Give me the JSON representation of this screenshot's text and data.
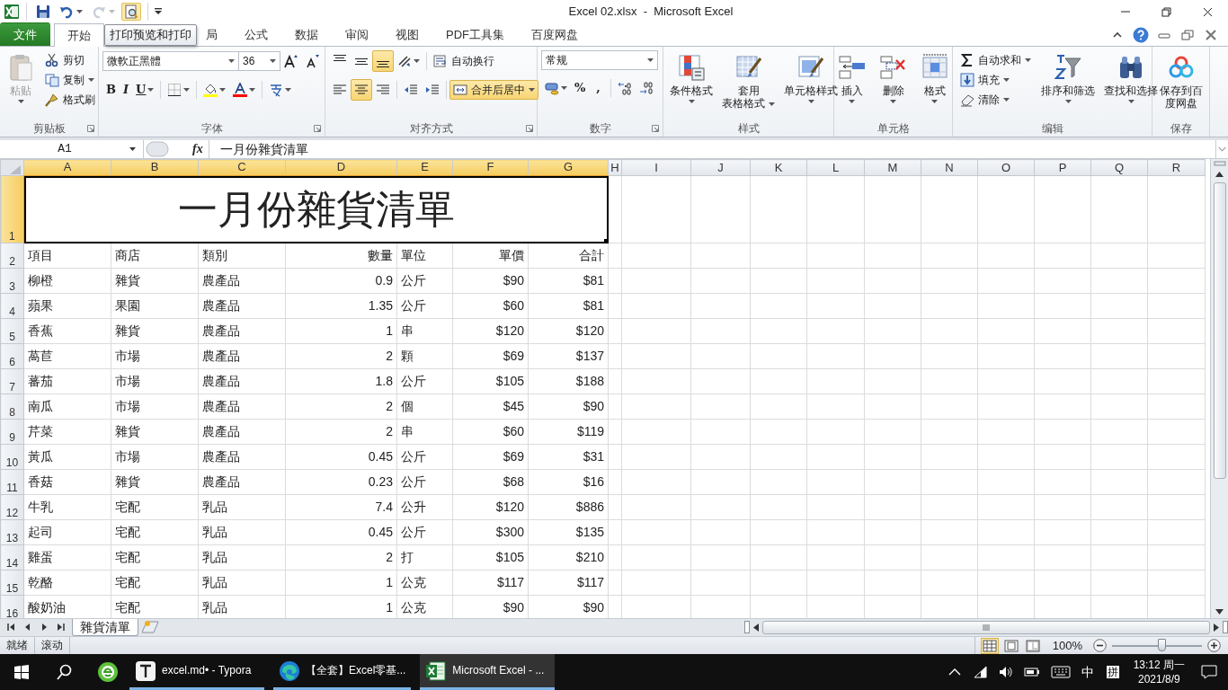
{
  "window": {
    "title": "Excel 02.xlsx  -  Microsoft Excel"
  },
  "quick_access": [
    {
      "disabled": false,
      "hovered": false
    },
    {
      "disabled": false,
      "hovered": false
    },
    {
      "disabled": true,
      "hovered": false
    },
    {
      "disabled": false,
      "hovered": true
    }
  ],
  "tooltip": {
    "text": "打印预览和打印"
  },
  "tabs": [
    {
      "label": "文件",
      "kind": "file",
      "selected": false
    },
    {
      "label": "开始",
      "kind": "tab",
      "selected": true
    },
    {
      "label": "局",
      "kind": "partial",
      "selected": false
    },
    {
      "label": "公式",
      "kind": "tab",
      "selected": false
    },
    {
      "label": "数据",
      "kind": "tab",
      "selected": false
    },
    {
      "label": "审阅",
      "kind": "tab",
      "selected": false
    },
    {
      "label": "视图",
      "kind": "tab",
      "selected": false
    },
    {
      "label": "PDF工具集",
      "kind": "tab",
      "selected": false
    },
    {
      "label": "百度网盘",
      "kind": "tab",
      "selected": false
    }
  ],
  "ribbon": {
    "clipboard": {
      "label": "剪贴板",
      "paste": {
        "label": "粘贴",
        "disabled": true
      },
      "cut": "剪切",
      "copy": "复制",
      "format_painter": "格式刷"
    },
    "font": {
      "label": "字体",
      "font_name": "微軟正黑體",
      "font_size": "36",
      "bold": "B",
      "italic": "I",
      "underline": "U"
    },
    "alignment": {
      "label": "对齐方式",
      "vertical": [
        {
          "selected": false
        },
        {
          "selected": false
        },
        {
          "selected": true
        }
      ],
      "horizontal": [
        {
          "selected": false
        },
        {
          "selected": true
        },
        {
          "selected": false
        }
      ],
      "wrap_text": "自动换行",
      "merge_center": {
        "label": "合并后居中",
        "selected": true
      }
    },
    "number": {
      "label": "数字",
      "format": "常规",
      "percent": "%",
      "comma": ","
    },
    "styles": {
      "label": "样式",
      "conditional": "条件格式",
      "table_format": [
        "套用",
        "表格格式"
      ],
      "cell_styles": "单元格样式"
    },
    "cells": {
      "label": "单元格",
      "buttons": [
        "插入",
        "删除",
        "格式"
      ]
    },
    "editing": {
      "label": "编辑",
      "autosum": "自动求和",
      "fill": "填充",
      "clear": "清除",
      "sort_filter": "排序和筛选",
      "find_select": "查找和选择"
    },
    "save": {
      "label": "保存",
      "button": [
        "保存到百",
        "度网盘"
      ]
    }
  },
  "formula_bar": {
    "name_box": "A1",
    "fx": "fx",
    "formula": "一月份雜貨清單"
  },
  "sheet": {
    "columns": [
      {
        "label": "A",
        "selected": true
      },
      {
        "label": "B",
        "selected": true
      },
      {
        "label": "C",
        "selected": true
      },
      {
        "label": "D",
        "selected": true
      },
      {
        "label": "E",
        "selected": true
      },
      {
        "label": "F",
        "selected": true
      },
      {
        "label": "G",
        "selected": true
      },
      {
        "label": "H",
        "selected": false
      },
      {
        "label": "I",
        "selected": false
      },
      {
        "label": "J",
        "selected": false
      },
      {
        "label": "K",
        "selected": false
      },
      {
        "label": "L",
        "selected": false
      },
      {
        "label": "M",
        "selected": false
      },
      {
        "label": "N",
        "selected": false
      },
      {
        "label": "O",
        "selected": false
      },
      {
        "label": "P",
        "selected": false
      },
      {
        "label": "Q",
        "selected": false
      },
      {
        "label": "R",
        "selected": false
      }
    ],
    "title_row": {
      "header": "1",
      "selected": true,
      "active": true,
      "text": "一月份雜貨清單"
    },
    "rows": [
      {
        "header": "2",
        "selected": false,
        "cells": [
          "項目",
          "商店",
          "類別",
          "數量",
          "單位",
          "單價",
          "合計"
        ]
      },
      {
        "header": "3",
        "selected": false,
        "cells": [
          "柳橙",
          "雜貨",
          "農產品",
          "0.9",
          "公斤",
          "$90",
          "$81"
        ]
      },
      {
        "header": "4",
        "selected": false,
        "cells": [
          "蘋果",
          "果園",
          "農產品",
          "1.35",
          "公斤",
          "$60",
          "$81"
        ]
      },
      {
        "header": "5",
        "selected": false,
        "cells": [
          "香蕉",
          "雜貨",
          "農產品",
          "1",
          "串",
          "$120",
          "$120"
        ]
      },
      {
        "header": "6",
        "selected": false,
        "cells": [
          "萵苣",
          "市場",
          "農產品",
          "2",
          "顆",
          "$69",
          "$137"
        ]
      },
      {
        "header": "7",
        "selected": false,
        "cells": [
          "蕃茄",
          "市場",
          "農產品",
          "1.8",
          "公斤",
          "$105",
          "$188"
        ]
      },
      {
        "header": "8",
        "selected": false,
        "cells": [
          "南瓜",
          "市場",
          "農產品",
          "2",
          "個",
          "$45",
          "$90"
        ]
      },
      {
        "header": "9",
        "selected": false,
        "cells": [
          "芹菜",
          "雜貨",
          "農產品",
          "2",
          "串",
          "$60",
          "$119"
        ]
      },
      {
        "header": "10",
        "selected": false,
        "cells": [
          "黃瓜",
          "市場",
          "農產品",
          "0.45",
          "公斤",
          "$69",
          "$31"
        ]
      },
      {
        "header": "11",
        "selected": false,
        "cells": [
          "香菇",
          "雜貨",
          "農產品",
          "0.23",
          "公斤",
          "$68",
          "$16"
        ]
      },
      {
        "header": "12",
        "selected": false,
        "cells": [
          "牛乳",
          "宅配",
          "乳品",
          "7.4",
          "公升",
          "$120",
          "$886"
        ]
      },
      {
        "header": "13",
        "selected": false,
        "cells": [
          "起司",
          "宅配",
          "乳品",
          "0.45",
          "公斤",
          "$300",
          "$135"
        ]
      },
      {
        "header": "14",
        "selected": false,
        "cells": [
          "雞蛋",
          "宅配",
          "乳品",
          "2",
          "打",
          "$105",
          "$210"
        ]
      },
      {
        "header": "15",
        "selected": false,
        "cells": [
          "乾酪",
          "宅配",
          "乳品",
          "1",
          "公克",
          "$117",
          "$117"
        ]
      },
      {
        "header": "16",
        "selected": false,
        "cells": [
          "酸奶油",
          "宅配",
          "乳品",
          "1",
          "公克",
          "$90",
          "$90"
        ]
      }
    ]
  },
  "sheet_tabs": [
    {
      "label": "雜貨清單",
      "selected": true
    }
  ],
  "status_bar": {
    "items": [
      "就绪",
      "滚动"
    ],
    "views": [
      {
        "selected": true
      },
      {
        "selected": false
      },
      {
        "selected": false
      }
    ],
    "zoom": {
      "reading": "100%",
      "level": 0.55
    }
  },
  "taskbar": {
    "apps": [
      {
        "label": "excel.md• - Typora",
        "active": false
      },
      {
        "label": "【全套】Excel零基...",
        "active": false
      },
      {
        "label": "Microsoft Excel - ...",
        "active": true
      }
    ],
    "tray": {
      "ime": "中",
      "ime_mode": "拼",
      "time": "13:12 周一",
      "date": "2021/8/9"
    }
  }
}
